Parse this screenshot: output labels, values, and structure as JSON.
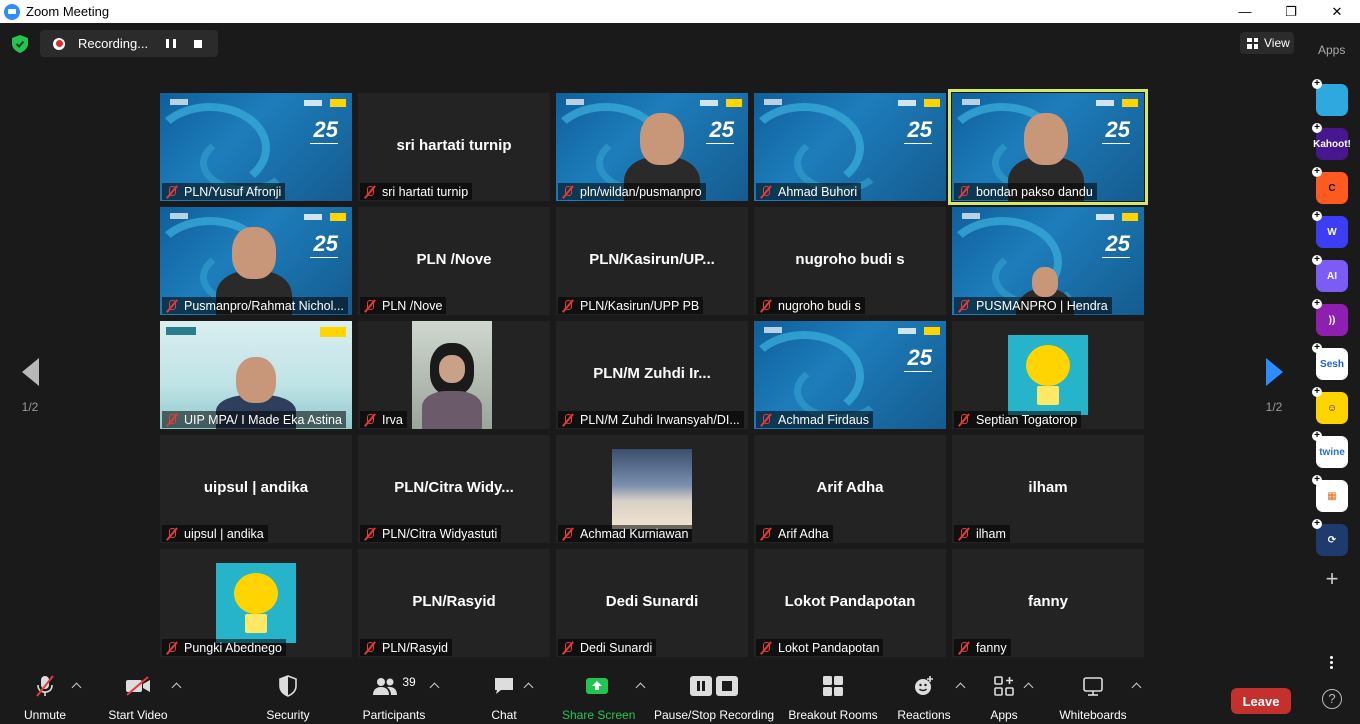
{
  "window": {
    "title": "Zoom Meeting",
    "minimize": "—",
    "maximize": "❐",
    "close": "✕"
  },
  "recording": {
    "label": "Recording..."
  },
  "view": {
    "label": "View"
  },
  "apps_panel": {
    "label": "Apps"
  },
  "pagination": {
    "left": "1/2",
    "right": "1/2"
  },
  "participants": [
    {
      "name": "PLN/Yusuf Afronji",
      "display": "",
      "video": "bg"
    },
    {
      "name": "sri hartati turnip",
      "display": "sri hartati turnip",
      "video": "none"
    },
    {
      "name": "pln/wildan/pusmanpro",
      "display": "",
      "video": "bg-person"
    },
    {
      "name": "Ahmad Buhori",
      "display": "",
      "video": "bg"
    },
    {
      "name": "bondan pakso dandu",
      "display": "",
      "video": "bg-person",
      "active": true
    },
    {
      "name": "Pusmanpro/Rahmat Nichol...",
      "display": "",
      "video": "bg-person"
    },
    {
      "name": "PLN /Nove",
      "display": "PLN /Nove",
      "video": "none"
    },
    {
      "name": "PLN/Kasirun/UPP PB",
      "display": "PLN/Kasirun/UP...",
      "video": "none"
    },
    {
      "name": "nugroho budi s",
      "display": "nugroho budi s",
      "video": "none"
    },
    {
      "name": "PUSMANPRO | Hendra",
      "display": "",
      "video": "bg-person"
    },
    {
      "name": "UIP MPA/ I Made Eka Astina",
      "display": "",
      "video": "light"
    },
    {
      "name": "Irva",
      "display": "",
      "video": "photo"
    },
    {
      "name": "PLN/M Zuhdi Irwansyah/DI...",
      "display": "PLN/M Zuhdi Ir...",
      "video": "none"
    },
    {
      "name": "Achmad Firdaus",
      "display": "",
      "video": "bg"
    },
    {
      "name": "Septian Togatorop",
      "display": "",
      "video": "bulb"
    },
    {
      "name": "uipsul | andika",
      "display": "uipsul | andika",
      "video": "none"
    },
    {
      "name": "PLN/Citra Widyastuti",
      "display": "PLN/Citra Widy...",
      "video": "none"
    },
    {
      "name": "Achmad Kurniawan",
      "display": "",
      "video": "sky"
    },
    {
      "name": "Arif Adha",
      "display": "Arif Adha",
      "video": "none"
    },
    {
      "name": "ilham",
      "display": "ilham",
      "video": "none"
    },
    {
      "name": "Pungki Abednego",
      "display": "",
      "video": "bulb"
    },
    {
      "name": "PLN/Rasyid",
      "display": "PLN/Rasyid",
      "video": "none"
    },
    {
      "name": "Dedi Sunardi",
      "display": "Dedi Sunardi",
      "video": "none"
    },
    {
      "name": "Lokot Pandapotan",
      "display": "Lokot Pandapotan",
      "video": "none"
    },
    {
      "name": "fanny",
      "display": "fanny",
      "video": "none"
    }
  ],
  "rail_apps": [
    {
      "name": "app-arrow-icon",
      "text": "",
      "bg": "#2fa8e0",
      "fg": "#111"
    },
    {
      "name": "kahoot-icon",
      "text": "Kahoot!",
      "bg": "#46178f",
      "fg": "#fff"
    },
    {
      "name": "app-c-icon",
      "text": "C",
      "bg": "#ff5a1f",
      "fg": "#111"
    },
    {
      "name": "app-w-icon",
      "text": "W",
      "bg": "#3d3df5",
      "fg": "#fff"
    },
    {
      "name": "app-ai-icon",
      "text": "AI",
      "bg": "#7b5cf5",
      "fg": "#fff"
    },
    {
      "name": "app-waves-icon",
      "text": "))",
      "bg": "#8e1fb0",
      "fg": "#fff"
    },
    {
      "name": "sesh-icon",
      "text": "Sesh",
      "bg": "#ffffff",
      "fg": "#1e5fd8"
    },
    {
      "name": "app-emoji-icon",
      "text": "☺",
      "bg": "#ffd400",
      "fg": "#111"
    },
    {
      "name": "twine-icon",
      "text": "twine",
      "bg": "#ffffff",
      "fg": "#2a6fd8"
    },
    {
      "name": "app-blocks-icon",
      "text": "▦",
      "bg": "#ffffff",
      "fg": "#e26b1f"
    },
    {
      "name": "app-sync-icon",
      "text": "⟳",
      "bg": "#1f3b6e",
      "fg": "#fff"
    }
  ],
  "toolbar": {
    "unmute": "Unmute",
    "start_video": "Start Video",
    "security": "Security",
    "participants": "Participants",
    "participants_count": "39",
    "chat": "Chat",
    "share_screen": "Share Screen",
    "pause_stop_recording": "Pause/Stop Recording",
    "breakout_rooms": "Breakout Rooms",
    "reactions": "Reactions",
    "apps": "Apps",
    "whiteboards": "Whiteboards",
    "leave": "Leave"
  },
  "colors": {
    "accent": "#2d8cff",
    "share": "#23c552",
    "leave": "#c4302b",
    "active_speaker": "#d6e86a",
    "muted": "#e53a3a"
  }
}
